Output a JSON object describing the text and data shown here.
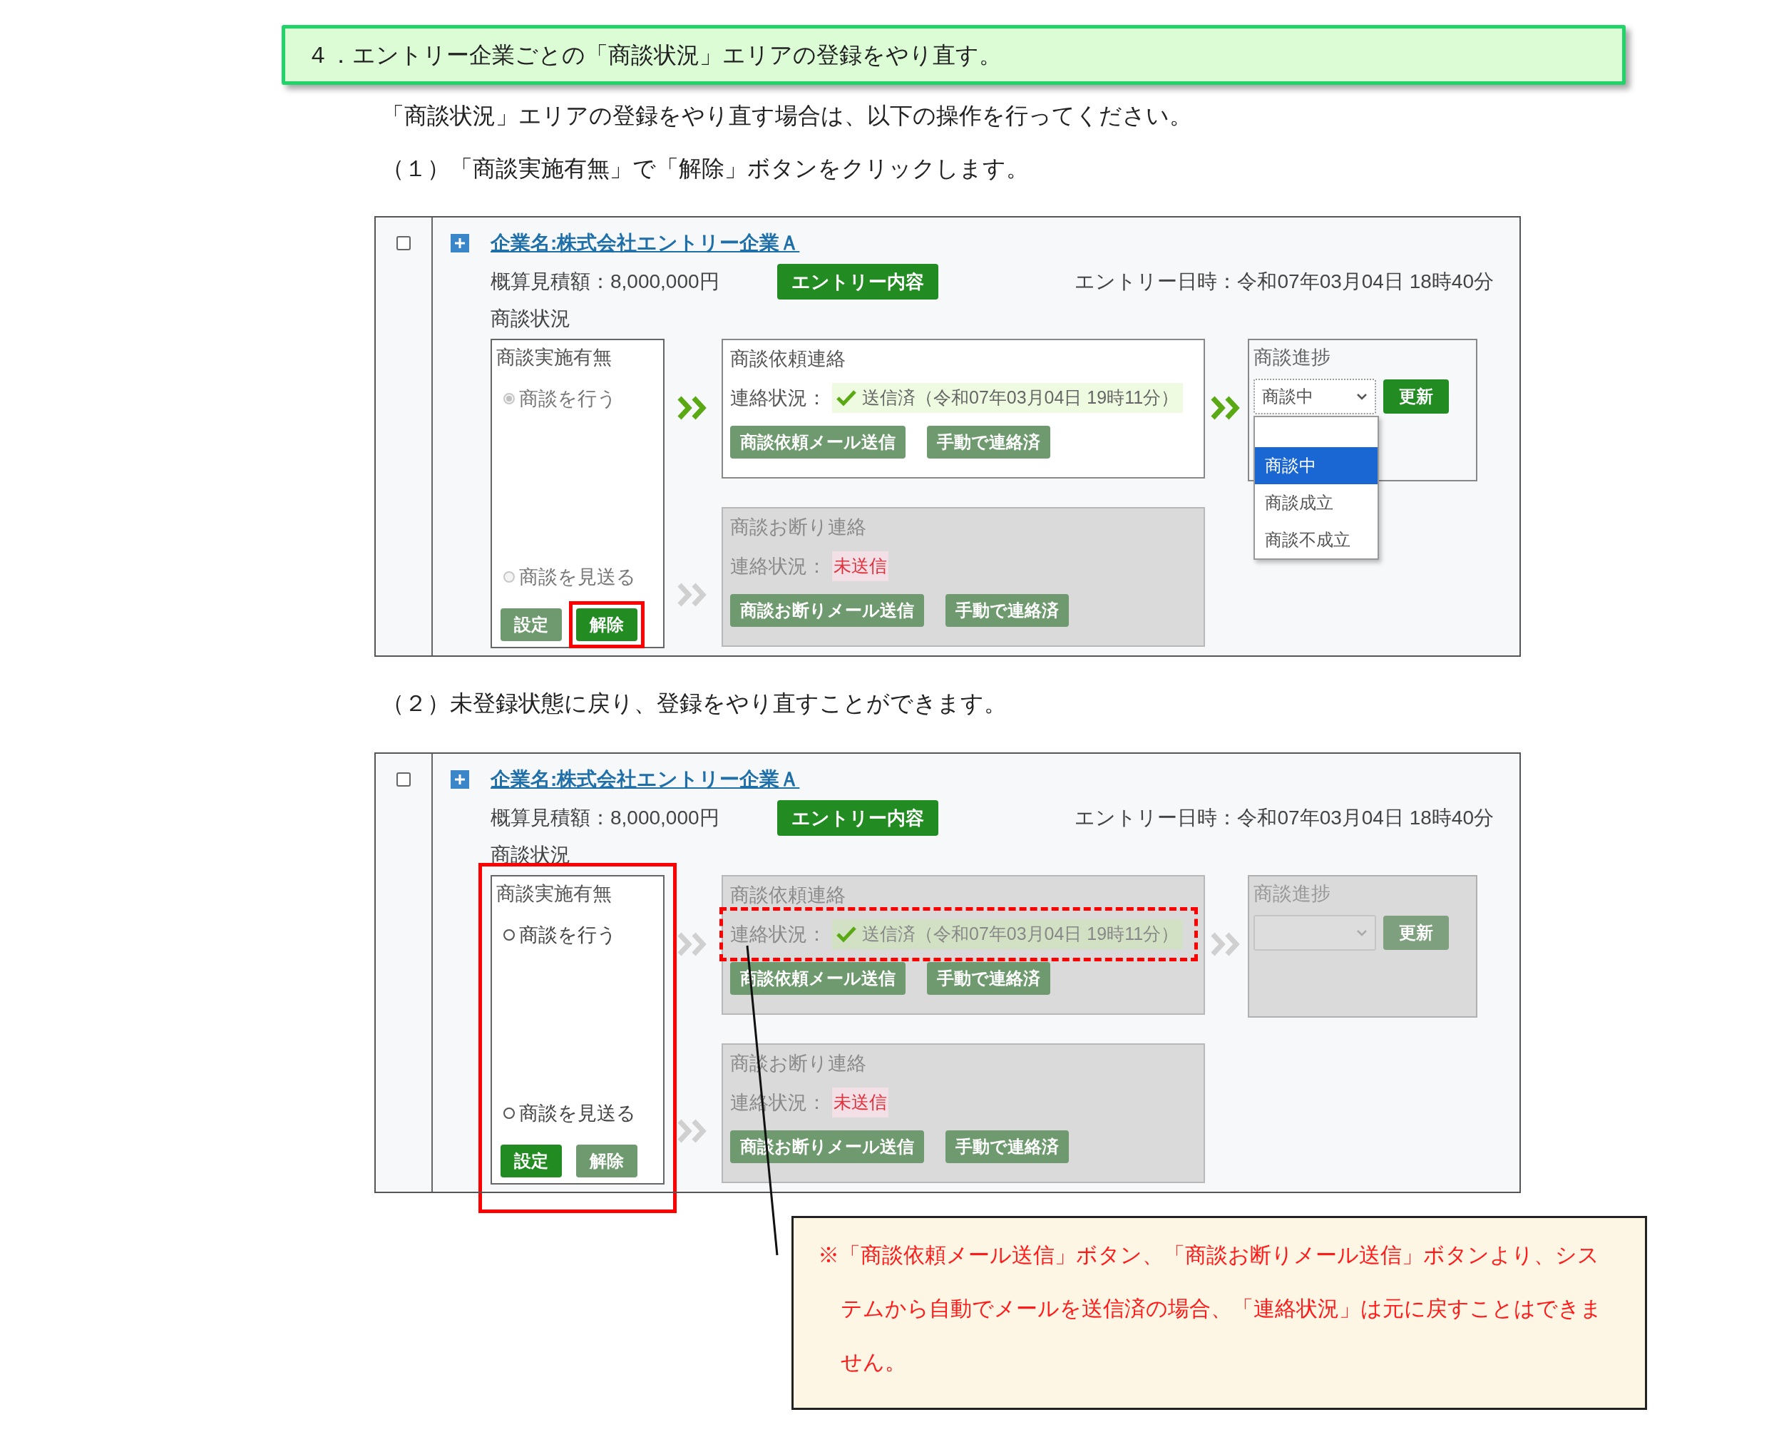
{
  "heading": "４．エントリー企業ごとの「商談状況」エリアの登録をやり直す。",
  "intro": "「商談状況」エリアの登録をやり直す場合は、以下の操作を行ってください。",
  "steps": [
    {
      "text": "（１）「商談実施有無」で「解除」ボタンをクリックします。",
      "shot": {
        "checkbox": {
          "checked": false
        },
        "company_link": "企業名:株式会社エントリー企業Ａ",
        "estimate": "概算見積額：8,000,000円",
        "entry_button": "エントリー内容",
        "entry_datetime": "エントリー日時：令和07年03月04日 18時40分",
        "section_label": "商談状況",
        "implementation": {
          "title": "商談実施有無",
          "options": [
            {
              "label": "商談を行う",
              "selected": true,
              "disabled": true
            },
            {
              "label": "商談を見送る",
              "selected": false,
              "disabled": true
            }
          ],
          "buttons": [
            {
              "label": "設定",
              "disabled": true,
              "highlighted": false
            },
            {
              "label": "解除",
              "disabled": false,
              "highlighted": true
            }
          ]
        },
        "request": {
          "title": "商談依頼連絡",
          "disabled": false,
          "status_label": "連絡状況：",
          "status": {
            "kind": "sent",
            "text": "送信済（令和07年03月04日 19時11分）"
          },
          "buttons": [
            {
              "label": "商談依頼メール送信",
              "disabled": true
            },
            {
              "label": "手動で連絡済",
              "disabled": true
            }
          ]
        },
        "decline": {
          "title": "商談お断り連絡",
          "disabled": true,
          "status_label": "連絡状況：",
          "status": {
            "kind": "unsent",
            "text": "未送信"
          },
          "buttons": [
            {
              "label": "商談お断りメール送信",
              "disabled": true
            },
            {
              "label": "手動で連絡済",
              "disabled": true
            }
          ]
        },
        "progress": {
          "title": "商談進捗",
          "disabled": false,
          "select_value": "商談中",
          "update_button": "更新",
          "dropdown_open": true,
          "options": [
            {
              "label": "商談中",
              "selected": true
            },
            {
              "label": "商談成立",
              "selected": false
            },
            {
              "label": "商談不成立",
              "selected": false
            }
          ]
        }
      }
    },
    {
      "text": "（２）未登録状態に戻り、登録をやり直すことができます。",
      "shot": {
        "checkbox": {
          "checked": false
        },
        "company_link": "企業名:株式会社エントリー企業Ａ",
        "estimate": "概算見積額：8,000,000円",
        "entry_button": "エントリー内容",
        "entry_datetime": "エントリー日時：令和07年03月04日 18時40分",
        "section_label": "商談状況",
        "implementation": {
          "title": "商談実施有無",
          "highlighted": true,
          "options": [
            {
              "label": "商談を行う",
              "selected": false,
              "disabled": false
            },
            {
              "label": "商談を見送る",
              "selected": false,
              "disabled": false
            }
          ],
          "buttons": [
            {
              "label": "設定",
              "disabled": false,
              "highlighted": false
            },
            {
              "label": "解除",
              "disabled": true,
              "highlighted": false
            }
          ]
        },
        "request": {
          "title": "商談依頼連絡",
          "disabled": true,
          "status_label": "連絡状況：",
          "status": {
            "kind": "sent",
            "text": "送信済（令和07年03月04日 19時11分）",
            "highlighted": true
          },
          "buttons": [
            {
              "label": "商談依頼メール送信",
              "disabled": true
            },
            {
              "label": "手動で連絡済",
              "disabled": true
            }
          ]
        },
        "decline": {
          "title": "商談お断り連絡",
          "disabled": true,
          "status_label": "連絡状況：",
          "status": {
            "kind": "unsent",
            "text": "未送信"
          },
          "buttons": [
            {
              "label": "商談お断りメール送信",
              "disabled": true
            },
            {
              "label": "手動で連絡済",
              "disabled": true
            }
          ]
        },
        "progress": {
          "title": "商談進捗",
          "disabled": true,
          "update_button": "更新"
        }
      }
    }
  ],
  "note": "※「商談依頼メール送信」ボタン、「商談お断りメール送信」ボタンより、システムから自動でメールを送信済の場合、「連絡状況」は元に戻すことはできません。"
}
